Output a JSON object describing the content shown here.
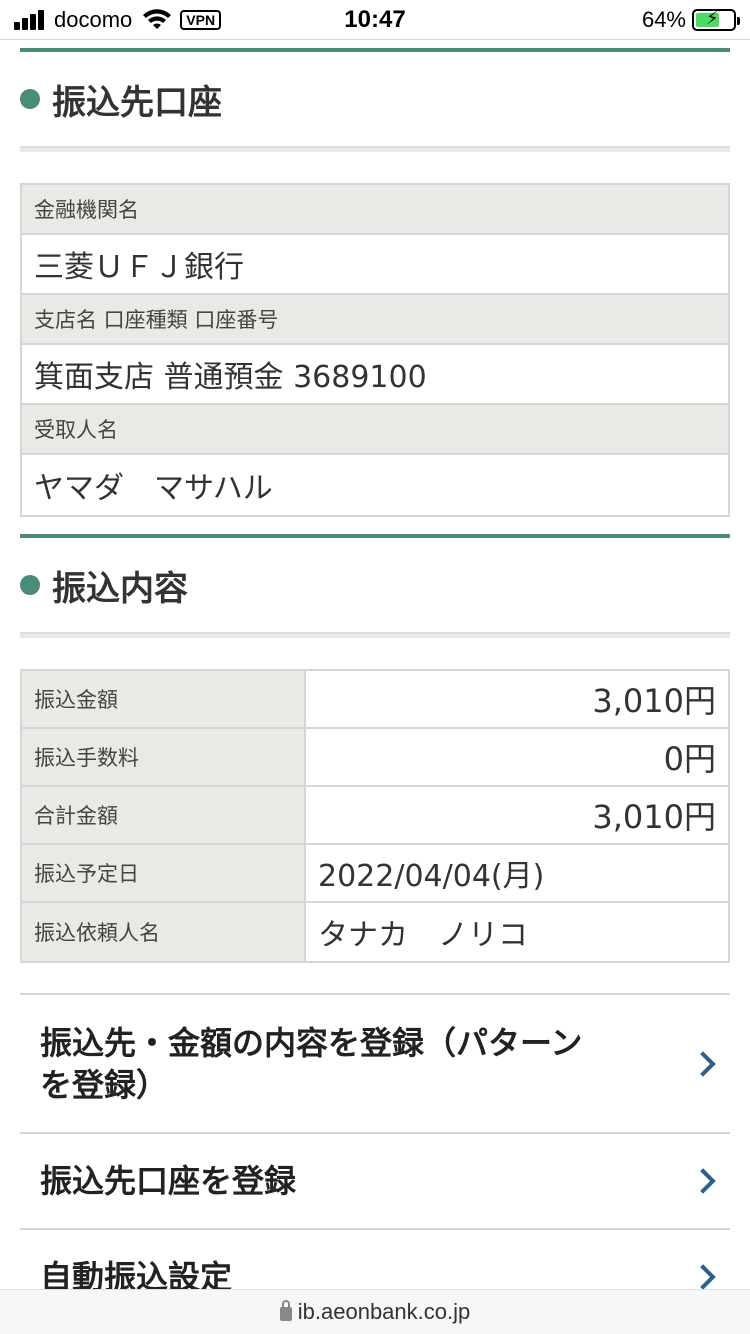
{
  "status_bar": {
    "carrier": "docomo",
    "vpn": "VPN",
    "time": "10:47",
    "battery_percent": "64%"
  },
  "recipient_section": {
    "title": "振込先口座",
    "rows": [
      {
        "label": "金融機関名",
        "value": "三菱ＵＦＪ銀行"
      },
      {
        "label": "支店名 口座種類 口座番号",
        "value": "箕面支店 普通預金 3689100"
      },
      {
        "label": "受取人名",
        "value": "ヤマダ　マサハル"
      }
    ]
  },
  "transfer_section": {
    "title": "振込内容",
    "rows": [
      {
        "label": "振込金額",
        "value": "3,010円"
      },
      {
        "label": "振込手数料",
        "value": "0円"
      },
      {
        "label": "合計金額",
        "value": "3,010円"
      },
      {
        "label": "振込予定日",
        "value": "2022/04/04(月)"
      },
      {
        "label": "振込依頼人名",
        "value": "タナカ　ノリコ"
      }
    ]
  },
  "menu": {
    "items": [
      {
        "label_line1": "振込先・金額の内容を登録（パターン",
        "label_line2": "を登録）"
      },
      {
        "label": "振込先口座を登録"
      },
      {
        "label": "自動振込設定"
      }
    ]
  },
  "url_bar": {
    "url": "ib.aeonbank.co.jp"
  },
  "colors": {
    "accent_green": "#4b8b7a",
    "label_bg": "#ebe9e6",
    "chevron_blue": "#2f5f8a"
  }
}
